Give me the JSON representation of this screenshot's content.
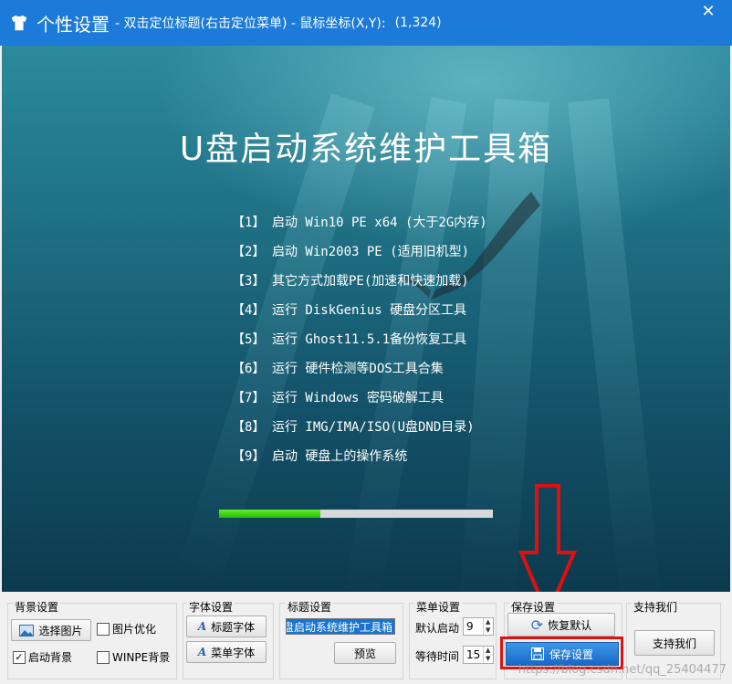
{
  "window": {
    "title": "个性设置",
    "subtitle": "- 双击定位标题(右击定位菜单) - 鼠标坐标(X,Y):",
    "coords": "(1,324)",
    "close_label": "✕"
  },
  "boot": {
    "title": "U盘启动系统维护工具箱",
    "menu": [
      {
        "num": "【1】",
        "text": "启动 Win10 PE x64 (大于2G内存)"
      },
      {
        "num": "【2】",
        "text": "启动 Win2003 PE (适用旧机型)"
      },
      {
        "num": "【3】",
        "text": "其它方式加载PE(加速和快速加载)"
      },
      {
        "num": "【4】",
        "text": "运行 DiskGenius 硬盘分区工具"
      },
      {
        "num": "【5】",
        "text": "运行 Ghost11.5.1备份恢复工具"
      },
      {
        "num": "【6】",
        "text": "运行 硬件检测等DOS工具合集"
      },
      {
        "num": "【7】",
        "text": "运行 Windows 密码破解工具"
      },
      {
        "num": "【8】",
        "text": "运行 IMG/IMA/ISO(U盘DND目录)"
      },
      {
        "num": "【9】",
        "text": "启动 硬盘上的操作系统"
      }
    ],
    "progress": 0.37
  },
  "panel": {
    "bg": {
      "title": "背景设置",
      "choose_image": "选择图片",
      "optimize_image": "图片优化",
      "optimize_checked": false,
      "boot_bg": "启动背景",
      "boot_bg_checked": true,
      "winpe_bg": "WINPE背景",
      "winpe_checked": false
    },
    "font": {
      "title": "字体设置",
      "title_font": "标题字体",
      "menu_font": "菜单字体"
    },
    "heading": {
      "title": "标题设置",
      "value": "U盘启动系统维护工具箱",
      "preview": "预览"
    },
    "menu": {
      "title": "菜单设置",
      "default_boot_label": "默认启动",
      "default_boot_value": "9",
      "wait_label": "等待时间",
      "wait_value": "15"
    },
    "save": {
      "title": "保存设置",
      "restore": "恢复默认",
      "save": "保存设置"
    },
    "support": {
      "title": "支持我们",
      "button": "支持我们"
    }
  },
  "watermark": "https://blog.csdn.net/qq_25404477",
  "colors": {
    "titlebar": "#1c7ad8",
    "highlight": "#e01010",
    "progress": "#3fd41a"
  }
}
